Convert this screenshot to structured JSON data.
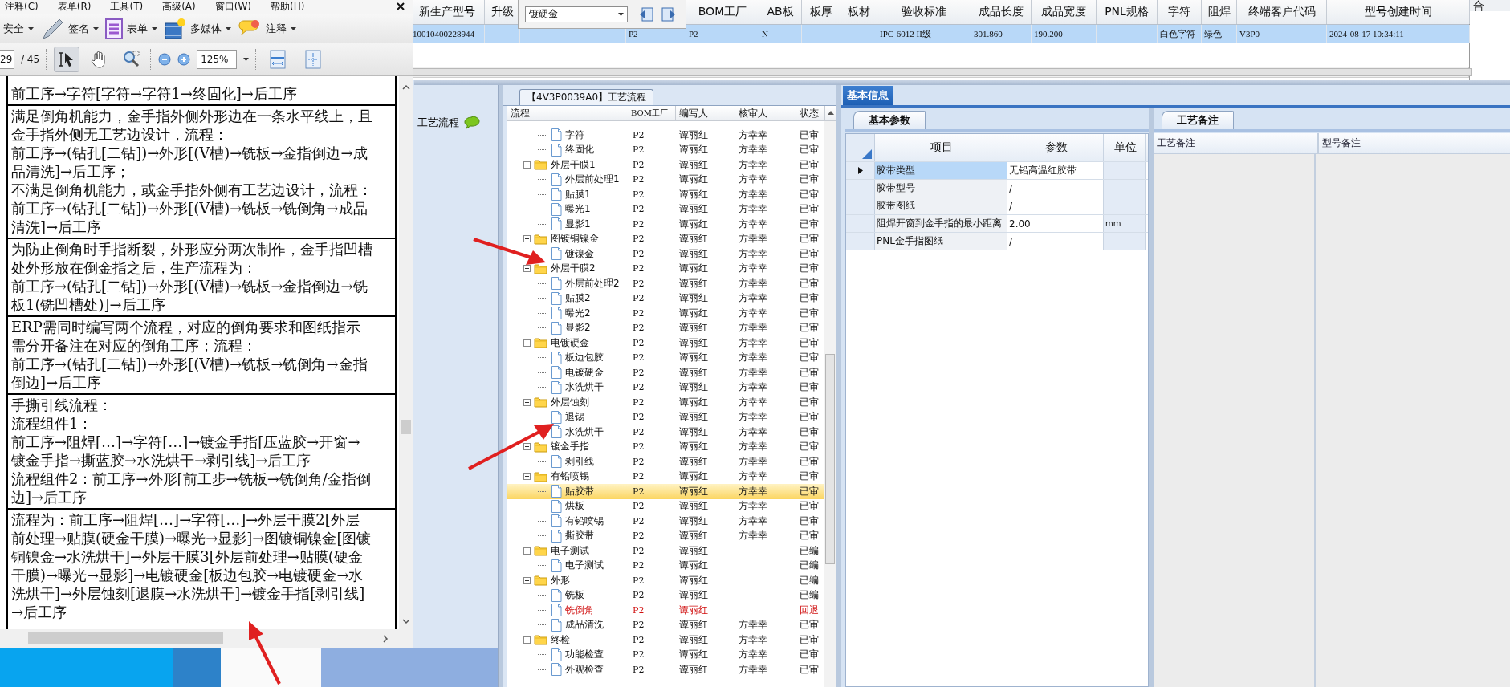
{
  "pdf_viewer": {
    "menu": [
      "注释(C)",
      "表单(R)",
      "工具(T)",
      "高级(A)",
      "窗口(W)",
      "帮助(H)"
    ],
    "toolbar": [
      {
        "label": "安全",
        "kind": "plain"
      },
      {
        "label": "签名",
        "kind": "pen"
      },
      {
        "label": "表单",
        "kind": "form"
      },
      {
        "label": "多媒体",
        "kind": "media"
      },
      {
        "label": "注释",
        "kind": "comment"
      }
    ],
    "page_field": {
      "value": "29"
    },
    "page_total": "/ 45",
    "tools": [
      {
        "kind": "select",
        "selected": true
      },
      {
        "kind": "hand",
        "selected": false
      },
      {
        "kind": "marquee-zoom",
        "selected": false
      }
    ],
    "zoom_buttons": [
      {
        "kind": "zoom-out"
      },
      {
        "kind": "zoom-in"
      }
    ],
    "zoom_field": {
      "value": "125%"
    },
    "fit_buttons": [
      {
        "kind": "fit-width"
      },
      {
        "kind": "fit-page"
      }
    ],
    "document_cells": [
      [
        "前工序→字符[字符→字符1→终固化]→后工序"
      ],
      [
        "满足倒角机能力，金手指外侧外形边在一条水平线上，且金手指外侧无工艺边设计，流程：",
        "前工序→(钻孔[二钻])→外形[(V槽)→铣板→金指倒边→成品清洗]→后工序；",
        "不满足倒角机能力，或金手指外侧有工艺边设计，流程：",
        "前工序→(钻孔[二钻])→外形[(V槽)→铣板→铣倒角→成品清洗]→后工序"
      ],
      [
        "为防止倒角时手指断裂，外形应分两次制作，金手指凹槽处外形放在倒金指之后，生产流程为：",
        "前工序→(钻孔[二钻])→外形[(V槽)→铣板→金指倒边→铣板1(铣凹槽处)]→后工序"
      ],
      [
        "ERP需同时编写两个流程，对应的倒角要求和图纸指示需分开备注在对应的倒角工序；流程：",
        "前工序→(钻孔[二钻])→外形[(V槽)→铣板→铣倒角→金指倒边]→后工序"
      ],
      [
        "手撕引线流程：",
        "流程组件1：",
        "前工序→阻焊[…]→字符[…]→镀金手指[压蓝胶→开窗→镀金手指→撕蓝胶→水洗烘干→剥引线]→后工序",
        "流程组件2：前工序→外形[前工步→铣板→铣倒角/金指倒边]→后工序"
      ],
      [
        "流程为：前工序→阻焊[…]→字符[…]→外层干膜2[外层前处理→贴膜(硬金干膜)→曝光→显影]→图镀铜镍金[图镀铜镍金→水洗烘干]→外层干膜3[外层前处理→贴膜(硬金干膜)→曝光→显影]→电镀硬金[板边包胶→电镀硬金→水洗烘干]→外层蚀刻[退膜→水洗烘干]→镀金手指[剥引线]→后工序"
      ]
    ]
  },
  "main_grid": {
    "columns": [
      {
        "label": "新生产型号"
      },
      {
        "label": "升级"
      },
      null,
      null,
      {
        "label": "BOM工厂"
      },
      {
        "label": "AB板"
      },
      {
        "label": "板厚"
      },
      {
        "label": "板材"
      },
      {
        "label": "验收标准"
      },
      {
        "label": "成品长度"
      },
      {
        "label": "成品宽度"
      },
      {
        "label": "PNL规格"
      },
      {
        "label": "字符"
      },
      {
        "label": "阻焊"
      },
      {
        "label": "终端客户代码"
      },
      {
        "label": "型号创建时间"
      }
    ],
    "rows": [
      {
        "selected": true,
        "cells": [
          "10010400228944",
          null,
          null,
          "P2",
          "P2",
          "N",
          null,
          null,
          "IPC-6012 II级",
          "301.860",
          "190.200",
          null,
          "白色字符",
          "绿色",
          "V3P0",
          "2024-08-17 10:34:11"
        ]
      }
    ]
  },
  "filter_popup": {
    "combo": {
      "value": "镀硬金"
    }
  },
  "merge_panel": {
    "header": "合"
  },
  "side_panel": {
    "tab": "工艺流程"
  },
  "process_tree": {
    "title": "【4V3P0039A0】工艺流程",
    "columns": [
      "流程",
      "BOM工厂",
      "编写人",
      "核审人",
      "状态"
    ],
    "items": [
      {
        "children": [
          {
            "kind": "step",
            "name": "字符",
            "bom": "P2",
            "writer": "谭丽红",
            "reviewer": "方幸幸",
            "status": "已审",
            "rejected": false,
            "selected": false
          },
          {
            "kind": "step",
            "name": "终固化",
            "bom": "P2",
            "writer": "谭丽红",
            "reviewer": "方幸幸",
            "status": "已审",
            "rejected": false,
            "selected": false
          }
        ]
      },
      {
        "kind": "folder",
        "name": "外层干膜1",
        "expanded": true,
        "bom": "P2",
        "writer": "谭丽红",
        "reviewer": "方幸幸",
        "status": "已审",
        "rejected": false,
        "selected": false,
        "children": [
          {
            "kind": "step",
            "name": "外层前处理1",
            "bom": "P2",
            "writer": "谭丽红",
            "reviewer": "方幸幸",
            "status": "已审",
            "rejected": false,
            "selected": false
          },
          {
            "kind": "step",
            "name": "贴膜1",
            "bom": "P2",
            "writer": "谭丽红",
            "reviewer": "方幸幸",
            "status": "已审",
            "rejected": false,
            "selected": false
          },
          {
            "kind": "step",
            "name": "曝光1",
            "bom": "P2",
            "writer": "谭丽红",
            "reviewer": "方幸幸",
            "status": "已审",
            "rejected": false,
            "selected": false
          },
          {
            "kind": "step",
            "name": "显影1",
            "bom": "P2",
            "writer": "谭丽红",
            "reviewer": "方幸幸",
            "status": "已审",
            "rejected": false,
            "selected": false
          }
        ]
      },
      {
        "kind": "folder",
        "name": "图镀铜镍金",
        "expanded": true,
        "bom": "P2",
        "writer": "谭丽红",
        "reviewer": "方幸幸",
        "status": "已审",
        "rejected": false,
        "selected": false,
        "children": [
          {
            "kind": "step",
            "name": "镀镍金",
            "bom": "P2",
            "writer": "谭丽红",
            "reviewer": "方幸幸",
            "status": "已审",
            "rejected": false,
            "selected": false
          }
        ]
      },
      {
        "kind": "folder",
        "name": "外层干膜2",
        "expanded": true,
        "bom": "P2",
        "writer": "谭丽红",
        "reviewer": "方幸幸",
        "status": "已审",
        "rejected": false,
        "selected": false,
        "children": [
          {
            "kind": "step",
            "name": "外层前处理2",
            "bom": "P2",
            "writer": "谭丽红",
            "reviewer": "方幸幸",
            "status": "已审",
            "rejected": false,
            "selected": false
          },
          {
            "kind": "step",
            "name": "贴膜2",
            "bom": "P2",
            "writer": "谭丽红",
            "reviewer": "方幸幸",
            "status": "已审",
            "rejected": false,
            "selected": false
          },
          {
            "kind": "step",
            "name": "曝光2",
            "bom": "P2",
            "writer": "谭丽红",
            "reviewer": "方幸幸",
            "status": "已审",
            "rejected": false,
            "selected": false
          },
          {
            "kind": "step",
            "name": "显影2",
            "bom": "P2",
            "writer": "谭丽红",
            "reviewer": "方幸幸",
            "status": "已审",
            "rejected": false,
            "selected": false
          }
        ]
      },
      {
        "kind": "folder",
        "name": "电镀硬金",
        "expanded": true,
        "bom": "P2",
        "writer": "谭丽红",
        "reviewer": "方幸幸",
        "status": "已审",
        "rejected": false,
        "selected": false,
        "children": [
          {
            "kind": "step",
            "name": "板边包胶",
            "bom": "P2",
            "writer": "谭丽红",
            "reviewer": "方幸幸",
            "status": "已审",
            "rejected": false,
            "selected": false
          },
          {
            "kind": "step",
            "name": "电镀硬金",
            "bom": "P2",
            "writer": "谭丽红",
            "reviewer": "方幸幸",
            "status": "已审",
            "rejected": false,
            "selected": false
          },
          {
            "kind": "step",
            "name": "水洗烘干",
            "bom": "P2",
            "writer": "谭丽红",
            "reviewer": "方幸幸",
            "status": "已审",
            "rejected": false,
            "selected": false
          }
        ]
      },
      {
        "kind": "folder",
        "name": "外层蚀刻",
        "expanded": true,
        "bom": "P2",
        "writer": "谭丽红",
        "reviewer": "方幸幸",
        "status": "已审",
        "rejected": false,
        "selected": false,
        "children": [
          {
            "kind": "step",
            "name": "退锡",
            "bom": "P2",
            "writer": "谭丽红",
            "reviewer": "方幸幸",
            "status": "已审",
            "rejected": false,
            "selected": false
          },
          {
            "kind": "step",
            "name": "水洗烘干",
            "bom": "P2",
            "writer": "谭丽红",
            "reviewer": "方幸幸",
            "status": "已审",
            "rejected": false,
            "selected": false
          }
        ]
      },
      {
        "kind": "folder",
        "name": "镀金手指",
        "expanded": true,
        "bom": "P2",
        "writer": "谭丽红",
        "reviewer": "方幸幸",
        "status": "已审",
        "rejected": false,
        "selected": false,
        "children": [
          {
            "kind": "step",
            "name": "剥引线",
            "bom": "P2",
            "writer": "谭丽红",
            "reviewer": "方幸幸",
            "status": "已审",
            "rejected": false,
            "selected": false
          }
        ]
      },
      {
        "kind": "folder",
        "name": "有铅喷锡",
        "expanded": true,
        "bom": "P2",
        "writer": "谭丽红",
        "reviewer": "方幸幸",
        "status": "已审",
        "rejected": false,
        "selected": false,
        "children": [
          {
            "kind": "step",
            "name": "贴胶带",
            "bom": "P2",
            "writer": "谭丽红",
            "reviewer": "方幸幸",
            "status": "已审",
            "rejected": false,
            "selected": true
          },
          {
            "kind": "step",
            "name": "烘板",
            "bom": "P2",
            "writer": "谭丽红",
            "reviewer": "方幸幸",
            "status": "已审",
            "rejected": false,
            "selected": false
          },
          {
            "kind": "step",
            "name": "有铅喷锡",
            "bom": "P2",
            "writer": "谭丽红",
            "reviewer": "方幸幸",
            "status": "已审",
            "rejected": false,
            "selected": false
          },
          {
            "kind": "step",
            "name": "撕胶带",
            "bom": "P2",
            "writer": "谭丽红",
            "reviewer": "方幸幸",
            "status": "已审",
            "rejected": false,
            "selected": false
          }
        ]
      },
      {
        "kind": "folder",
        "name": "电子测试",
        "expanded": true,
        "bom": "P2",
        "writer": "谭丽红",
        "status": "已编",
        "rejected": false,
        "selected": false,
        "children": [
          {
            "kind": "step",
            "name": "电子测试",
            "bom": "P2",
            "writer": "谭丽红",
            "status": "已编",
            "rejected": false,
            "selected": false
          }
        ]
      },
      {
        "kind": "folder",
        "name": "外形",
        "expanded": true,
        "bom": "P2",
        "writer": "谭丽红",
        "status": "已编",
        "rejected": false,
        "selected": false,
        "children": [
          {
            "kind": "step",
            "name": "铣板",
            "bom": "P2",
            "writer": "谭丽红",
            "status": "已编",
            "rejected": false,
            "selected": false
          },
          {
            "kind": "step",
            "name": "铣倒角",
            "bom": "P2",
            "writer": "谭丽红",
            "status": "回退",
            "rejected": true,
            "selected": false
          },
          {
            "kind": "step",
            "name": "成品清洗",
            "bom": "P2",
            "writer": "谭丽红",
            "reviewer": "方幸幸",
            "status": "已审",
            "rejected": false,
            "selected": false
          }
        ]
      },
      {
        "kind": "folder",
        "name": "终检",
        "expanded": true,
        "bom": "P2",
        "writer": "谭丽红",
        "reviewer": "方幸幸",
        "status": "已审",
        "rejected": false,
        "selected": false,
        "children": [
          {
            "kind": "step",
            "name": "功能检查",
            "bom": "P2",
            "writer": "谭丽红",
            "reviewer": "方幸幸",
            "status": "已审",
            "rejected": false,
            "selected": false
          },
          {
            "kind": "step",
            "name": "外观检查",
            "bom": "P2",
            "writer": "谭丽红",
            "reviewer": "方幸幸",
            "status": "已审",
            "rejected": false,
            "selected": false
          }
        ]
      }
    ]
  },
  "detail": {
    "tab": "基本信息",
    "params": {
      "tab": "基本参数",
      "columns": [
        "项目",
        "参数",
        "单位"
      ],
      "rows": [
        {
          "item": "胶带类型",
          "value": "无铅高温红胶带",
          "selected": true
        },
        {
          "item": "胶带型号",
          "value": "/",
          "selected": false
        },
        {
          "item": "胶带图纸",
          "value": "/",
          "selected": false
        },
        {
          "item": "阻焊开窗到金手指的最小距离",
          "value": "2.00",
          "unit": "mm",
          "selected": false
        },
        {
          "item": "PNL金手指图纸",
          "value": "/",
          "selected": false
        }
      ]
    },
    "notes": {
      "tab": "工艺备注",
      "columns": [
        "工艺备注",
        "型号备注"
      ]
    }
  }
}
